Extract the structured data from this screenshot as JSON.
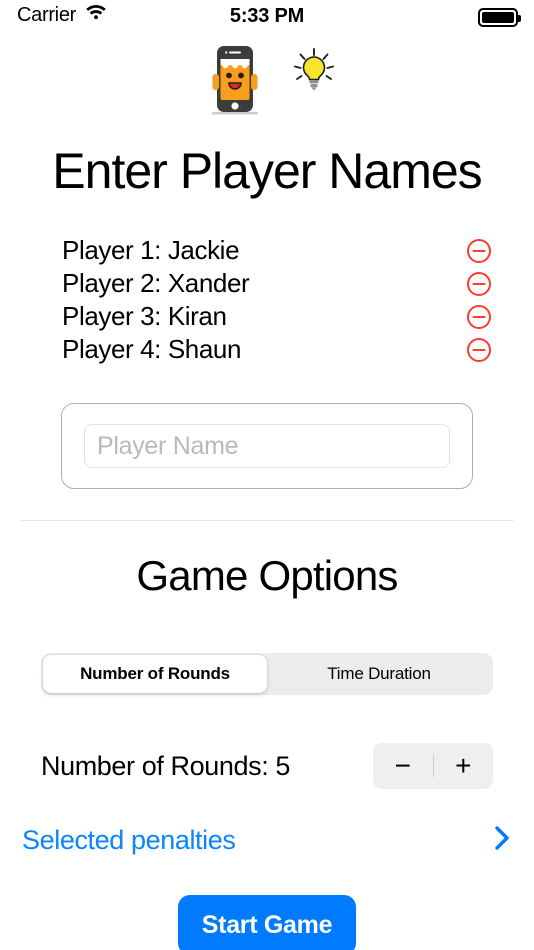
{
  "status_bar": {
    "carrier": "Carrier",
    "wifi_icon": "wifi-icon",
    "time": "5:33 PM",
    "battery_icon": "battery-full-icon"
  },
  "logo": {
    "name": "phone-character-lightbulb-logo",
    "colors": {
      "phone_body": "#3c3c3c",
      "face": "#f79e1b",
      "bulb": "#f5e62c",
      "mouth": "#e8262a"
    }
  },
  "header": {
    "title": "Enter Player Names"
  },
  "players": {
    "remove_icon": "minus-circle-icon",
    "remove_color": "#ff3b30",
    "items": [
      {
        "label": "Player 1: Jackie"
      },
      {
        "label": "Player 2: Xander"
      },
      {
        "label": "Player 3: Kiran"
      },
      {
        "label": "Player 4: Shaun"
      }
    ]
  },
  "add_player": {
    "placeholder": "Player Name",
    "value": ""
  },
  "game_options": {
    "title": "Game Options",
    "mode_tabs": [
      {
        "label": "Number of Rounds",
        "selected": true
      },
      {
        "label": "Time Duration",
        "selected": false
      }
    ],
    "rounds": {
      "label": "Number of Rounds: 5",
      "value": "5",
      "decrement_label": "−",
      "increment_label": "+"
    },
    "penalties": {
      "label": "Selected penalties",
      "chevron_icon": "chevron-right-icon",
      "color": "#0a84ff"
    }
  },
  "footer": {
    "start_label": "Start Game",
    "start_color": "#007aff"
  }
}
